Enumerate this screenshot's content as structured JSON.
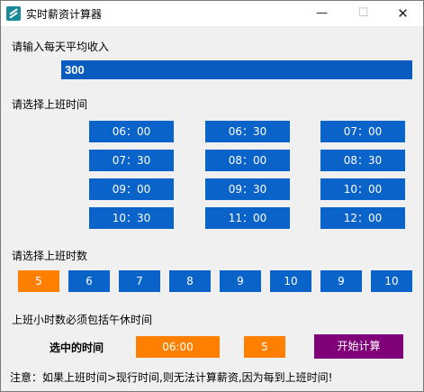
{
  "window": {
    "title": "实时薪资计算器",
    "min": "—",
    "max": "☐",
    "close": "✕"
  },
  "daily_income": {
    "label": "请输入每天平均收入",
    "value": "300"
  },
  "start_time": {
    "label": "请选择上班时间",
    "options": [
      "06：00",
      "06：30",
      "07：00",
      "07：30",
      "08：00",
      "08：30",
      "09：00",
      "09：30",
      "10：00",
      "10：30",
      "11：00",
      "12：00"
    ]
  },
  "work_hours": {
    "label": "请选择上班时数",
    "options": [
      "5",
      "6",
      "7",
      "8",
      "9",
      "10",
      "9",
      "10"
    ],
    "selected_index": 0
  },
  "note_lunch": "上班小时数必须包括午休时间",
  "selection": {
    "label": "选中的时间",
    "time": "06:00",
    "hours": "5"
  },
  "start_button": "开始计算",
  "warning": "注意：如果上班时间>现行时间,则无法计算薪资,因为每到上班时间!",
  "colors": {
    "button_blue": "#0a63c9",
    "selected_orange": "#ff8000",
    "start_purple": "#80007a"
  }
}
